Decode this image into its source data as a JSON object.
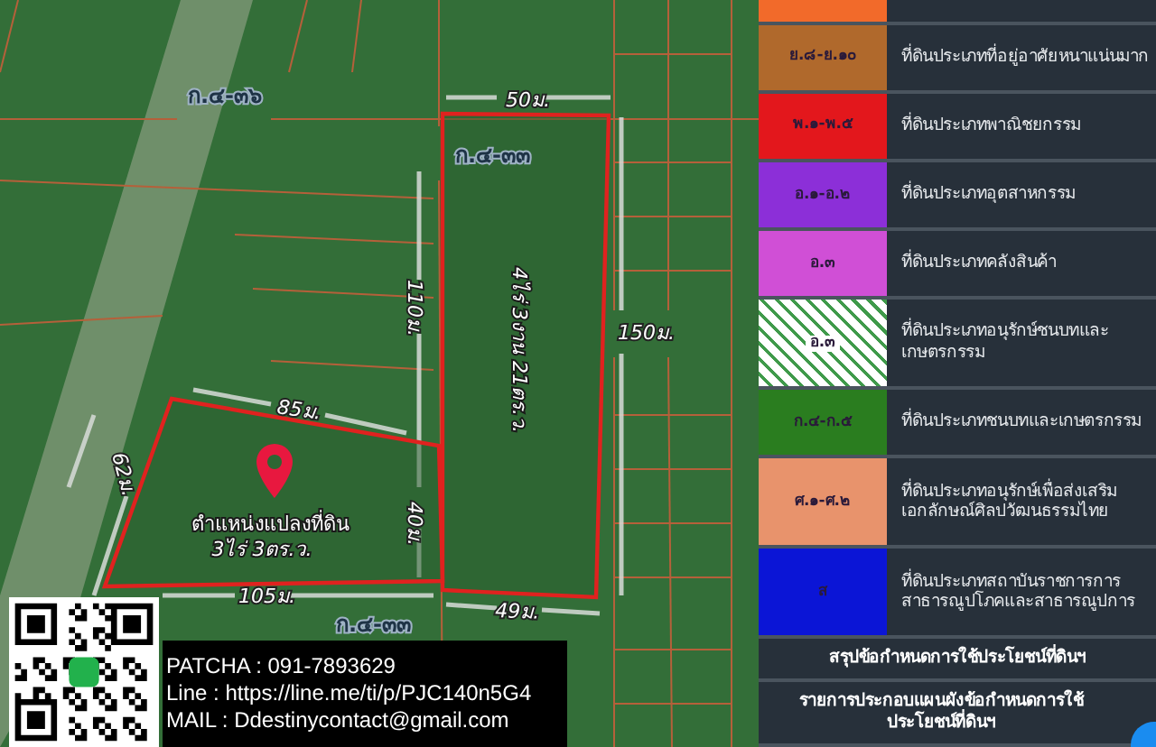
{
  "map": {
    "zone_labels": [
      "ก.๔-๓๖",
      "ก.๔-๓๓",
      "ก.๔-๓๓"
    ],
    "measurements": [
      "50ม.",
      "110ม.",
      "150ม.",
      "85ม.",
      "62ม.",
      "40ม.",
      "105ม.",
      "49ม."
    ],
    "plots": [
      {
        "kind": "neighbour",
        "area": "4ไร่ 3งาน 21ตร.ว."
      },
      {
        "kind": "subject",
        "title": "ตำแหน่งแปลงที่ดิน",
        "area": "3ไร่ 3ตร.ว."
      }
    ]
  },
  "contact": {
    "lines": [
      "PATCHA : 091-7893629",
      "Line : https://line.me/ti/p/PJC140n5G4",
      "MAIL : Ddestinycontact@gmail.com"
    ]
  },
  "legend": {
    "rows": [
      {
        "kind": "solid",
        "color": "#f26a2a"
      },
      {
        "kind": "solid",
        "color": "#b0692c",
        "code": "ย.๘-ย.๑๐",
        "description": "ที่ดินประเภทที่อยู่อาศัยหนาแน่นมาก"
      },
      {
        "kind": "solid",
        "color": "#e3171c",
        "code": "พ.๑-พ.๕",
        "description": "ที่ดินประเภทพาณิชยกรรม"
      },
      {
        "kind": "solid",
        "color": "#8c2fd8",
        "code": "อ.๑-อ.๒",
        "description": "ที่ดินประเภทอุตสาหกรรม"
      },
      {
        "kind": "solid",
        "color": "#d04fd6",
        "code": "อ.๓",
        "description": "ที่ดินประเภทคลังสินค้า"
      },
      {
        "kind": "hatched",
        "color": "#3f9a4a",
        "code": "อ.๓",
        "description": "ที่ดินประเภทอนุรักษ์ชนบทและเกษตรกรรม"
      },
      {
        "kind": "solid",
        "color": "#2a7d1f",
        "code": "ก.๔-ก.๕",
        "description": "ที่ดินประเภทชนบทและเกษตรกรรม"
      },
      {
        "kind": "solid",
        "color": "#e8936c",
        "code": "ศ.๑-ศ.๒",
        "description": "ที่ดินประเภทอนุรักษ์เพื่อส่งเสริมเอกลักษณ์ศิลปวัฒนธรรมไทย"
      },
      {
        "kind": "solid",
        "color": "#0b15d6",
        "code": "ส",
        "description": "ที่ดินประเภทสถาบันราชการการสาธารณูปโภคและสาธารณูปการ"
      }
    ],
    "links": [
      "สรุปข้อกำหนดการใช้ประโยชน์ที่ดินฯ",
      "รายการประกอบแผนผังข้อกำหนดการใช้ประโยชน์ที่ดินฯ"
    ]
  }
}
